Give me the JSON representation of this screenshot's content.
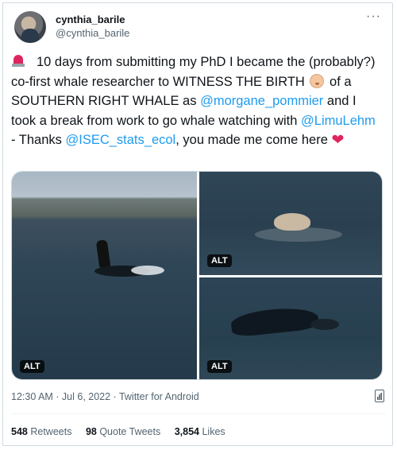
{
  "author": {
    "display_name": "cynthia_barile",
    "handle": "@cynthia_barile"
  },
  "more_label": "···",
  "tweet": {
    "t1": "10 days from submitting my PhD I became the (probably?) co-first whale researcher to WITNESS THE BIRTH",
    "t2": "of a SOUTHERN RIGHT WHALE as",
    "m1": "@morgane_pommier",
    "t3": "and I took a break from work to go whale watching with",
    "m2": "@LimuLehm",
    "t4": "- Thanks",
    "m3": "@ISEC_stats_ecol",
    "t5": ", you made me come here"
  },
  "icons": {
    "siren": "rotating-light-icon",
    "baby": "baby-icon",
    "heart": "red-heart-icon",
    "analytics": "analytics-icon"
  },
  "media": {
    "alt_label": "ALT"
  },
  "meta": {
    "timestamp": "12:30 AM · Jul 6, 2022 · Twitter for Android"
  },
  "stats": {
    "retweets_count": "548",
    "retweets_label": "Retweets",
    "quotes_count": "98",
    "quotes_label": "Quote Tweets",
    "likes_count": "3,854",
    "likes_label": "Likes"
  },
  "colors": {
    "link": "#1d9bf0",
    "heart": "#e0245e",
    "muted": "#536471"
  }
}
